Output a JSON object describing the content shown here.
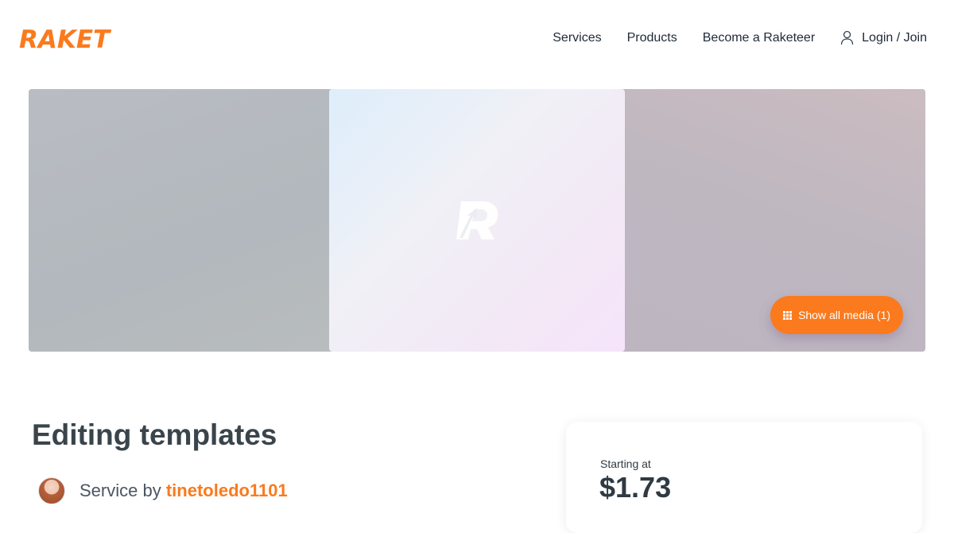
{
  "brand": {
    "logo_text": "RAKET",
    "accent": "#fa7a1d"
  },
  "nav": {
    "items": [
      "Services",
      "Products",
      "Become a Raketeer"
    ],
    "login_label": "Login / Join",
    "login_icon": "user-icon"
  },
  "media": {
    "show_all_label": "Show all media (1)",
    "show_all_icon": "grid-icon",
    "placeholder_icon": "raket-r-logo"
  },
  "listing": {
    "title": "Editing templates",
    "service_by_prefix": "Service by",
    "username": "tinetoledo1101"
  },
  "pricing": {
    "starting_label": "Starting at",
    "price": "$1.73"
  }
}
